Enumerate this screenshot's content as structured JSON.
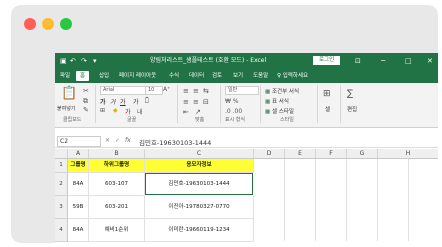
{
  "window": {
    "title": "양림처리스트_샘플테스트 (호환 모드) - Excel",
    "user_badge": "로그인",
    "quick_access": [
      "save",
      "undo",
      "redo",
      "customize"
    ],
    "controls": [
      "ribbon-options",
      "minimize",
      "maximize",
      "close"
    ]
  },
  "colors": {
    "traffic_red": "#ff5f57",
    "traffic_yellow": "#febc2e",
    "traffic_green": "#28c840",
    "excel_green": "#217346",
    "header_fill": "#ffff33",
    "active_cell_border": "#217346"
  },
  "tabs": [
    "파일",
    "홈",
    "삽입",
    "페이지 레이아웃",
    "수식",
    "데이터",
    "검토",
    "보기",
    "도움말",
    "♀ 입력하세요"
  ],
  "active_tab": "홈",
  "ribbon": {
    "clipboard": {
      "paste_label": "붙여넣기",
      "group_label": "클립보드"
    },
    "font": {
      "font_name": "Arial",
      "font_size": "10",
      "group_label": "글꼴"
    },
    "alignment": {
      "group_label": "맞춤"
    },
    "number": {
      "format": "일반",
      "group_label": "표시 형식"
    },
    "styles": {
      "items": [
        "조건부 서식",
        "표 서식",
        "셀 스타일"
      ],
      "group_label": "스타일"
    },
    "cells": {
      "label": "셀"
    },
    "editing": {
      "label": "편집"
    }
  },
  "formula_bar": {
    "name_box": "C2",
    "fx": "fx",
    "value": "김민호-19630103-1444"
  },
  "sheet": {
    "columns": [
      "A",
      "B",
      "C",
      "D",
      "E",
      "F",
      "G",
      "H"
    ],
    "rows": [
      {
        "num": "1",
        "a": "그룹명",
        "b": "하위그룹명",
        "c": "응모자정보"
      },
      {
        "num": "2",
        "a": "84A",
        "b": "603-107",
        "c": "김민호-19630103-1444"
      },
      {
        "num": "3",
        "a": "59B",
        "b": "603-201",
        "c": "이진아-19780327-0770"
      },
      {
        "num": "4",
        "a": "84A",
        "b": "예비1순위",
        "c": "이미란-19660119-1234"
      }
    ]
  }
}
